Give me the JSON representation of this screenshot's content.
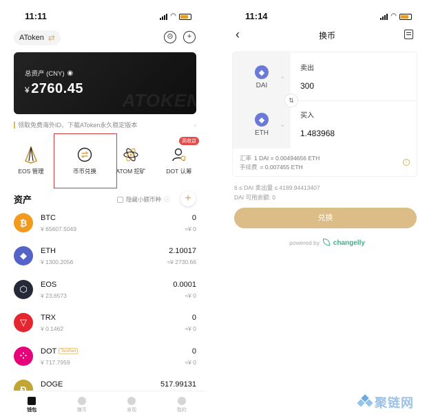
{
  "left": {
    "time": "11:11",
    "wallet_name": "AToken",
    "card": {
      "label": "总资产 (CNY)",
      "currency": "¥",
      "amount": "2760.45",
      "watermark": "ATOKEN"
    },
    "notice": "领取免费海外ID、下载AToken永久稳定版本",
    "quick_actions": [
      {
        "label": "EOS 管理"
      },
      {
        "label": "币币兑换"
      },
      {
        "label": "ATOM 挖矿"
      },
      {
        "label": "DOT 认筹"
      }
    ],
    "hot_badge": "高收益",
    "assets_title": "资产",
    "hide_small": "隐藏小额币种",
    "assets": [
      {
        "symbol": "BTC",
        "price": "¥ 65607.5049",
        "balance": "0",
        "value": "≈¥ 0",
        "color": "#f29a1e",
        "icon": "bitcoin-icon",
        "glyph": "₿"
      },
      {
        "symbol": "ETH",
        "price": "¥ 1300.2056",
        "balance": "2.10017",
        "value": "≈¥ 2730.66",
        "color": "#5363c7",
        "icon": "ethereum-icon",
        "glyph": "◆"
      },
      {
        "symbol": "EOS",
        "price": "¥ 23.6573",
        "balance": "0.0001",
        "value": "≈¥ 0",
        "color": "#262a38",
        "icon": "eos-icon",
        "glyph": "⬡"
      },
      {
        "symbol": "TRX",
        "price": "¥ 0.1462",
        "balance": "0",
        "value": "≈¥ 0",
        "color": "#e3262f",
        "icon": "tron-icon",
        "glyph": "▽"
      },
      {
        "symbol": "DOT",
        "price": "¥ 717.7959",
        "balance": "0",
        "value": "≈¥ 0",
        "color": "#e6007a",
        "icon": "polkadot-icon",
        "glyph": "⁘",
        "tag": "TestNet"
      },
      {
        "symbol": "DOGE",
        "price": "",
        "balance": "517.99131",
        "value": "",
        "color": "#c2a633",
        "icon": "dogecoin-icon",
        "glyph": "Ð"
      }
    ],
    "tabs": [
      {
        "label": "钱包",
        "active": true
      },
      {
        "label": "赚币",
        "active": false
      },
      {
        "label": "发现",
        "active": false
      },
      {
        "label": "我的",
        "active": false
      }
    ]
  },
  "right": {
    "time": "11:14",
    "title": "换币",
    "sell": {
      "coin": "DAI",
      "label": "卖出",
      "value": "300"
    },
    "buy": {
      "coin": "ETH",
      "label": "买入",
      "value": "1.483968"
    },
    "rate_label": "汇率",
    "rate_value": "1 DAI = 0.00494656 ETH",
    "fee_label": "手续费",
    "fee_value": "= 0.007455 ETH",
    "limit_text": "6 ≤ DAI 卖出量 ≤ 4189.94413407",
    "available_text": "DAI 可用余额: 0",
    "exchange_button": "兑换",
    "powered_by": "powered by",
    "provider": "changelly"
  },
  "site_watermark": "聚链网",
  "colors": {
    "accent": "#dcbd87",
    "highlight": "#d23b3b",
    "card_bg": "#1a1a1a"
  }
}
